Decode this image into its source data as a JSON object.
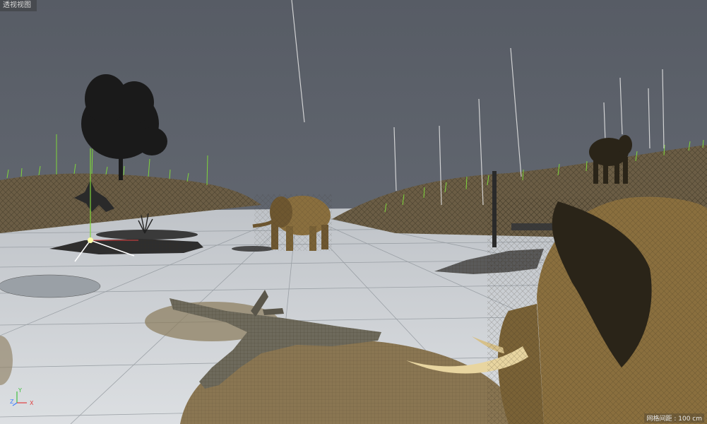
{
  "viewport": {
    "view_name": "透视视图",
    "grid_spacing_label": "网格间距 : 100 cm"
  },
  "axis_gizmo": {
    "y": "Y",
    "z": "Z",
    "x": "X"
  },
  "colors": {
    "sky": "#5d626b",
    "ground": "#c9cdd1",
    "grass": "#7fd63a",
    "hill": "#6b5d45",
    "elephant": "#8a6f3e",
    "axis_x": "#e04040",
    "axis_y": "#40c040",
    "axis_z": "#4080ff"
  }
}
